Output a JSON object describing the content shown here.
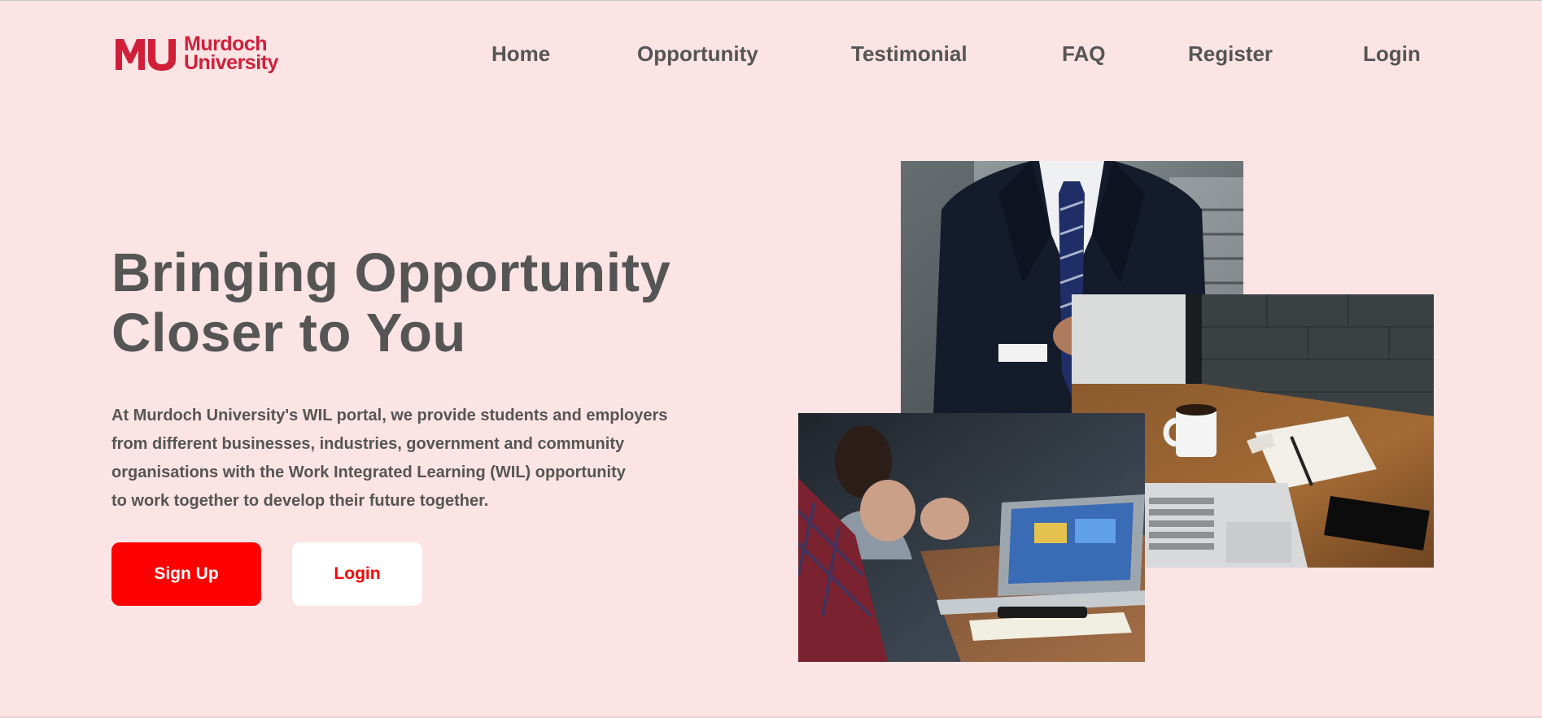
{
  "header": {
    "logo": {
      "mark": "MU",
      "line1": "Murdoch",
      "line2": "University"
    },
    "nav": [
      {
        "label": "Home"
      },
      {
        "label": "Opportunity"
      },
      {
        "label": "Testimonial"
      },
      {
        "label": "FAQ"
      },
      {
        "label": "Register"
      },
      {
        "label": "Login"
      }
    ]
  },
  "hero": {
    "headline_line1": "Bringing Opportunity",
    "headline_line2": "Closer to You",
    "intro_lines": [
      "At Murdoch University's WIL portal, we provide students and employers",
      "from different businesses, industries, government and community",
      "organisations with the Work Integrated Learning (WIL) opportunity",
      "to work together to develop their future together."
    ],
    "signup_label": "Sign Up",
    "login_label": "Login"
  },
  "images": {
    "suit": "businessman-in-suit-photo",
    "desk": "laptop-coffee-notepad-desk-photo",
    "meeting": "team-meeting-laptop-photo"
  },
  "colors": {
    "background": "#fde4e4",
    "brand_red": "#d11f3a",
    "primary_button": "#ff0000",
    "text": "#555555"
  }
}
